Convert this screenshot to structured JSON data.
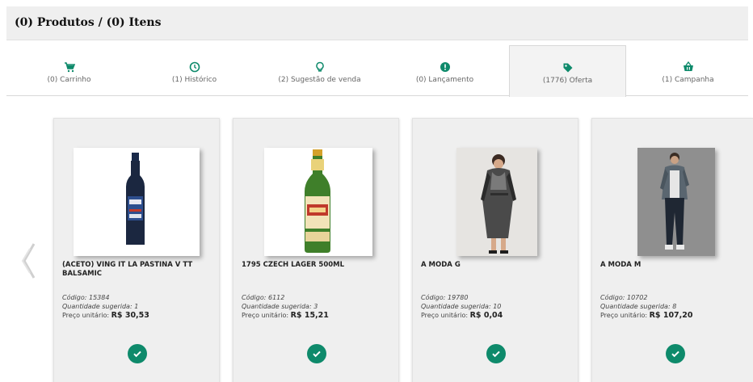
{
  "header": {
    "title": "(0) Produtos / (0) Itens"
  },
  "tabs": [
    {
      "label": "(0) Carrinho",
      "icon": "cart-icon"
    },
    {
      "label": "(1) Histórico",
      "icon": "history-icon"
    },
    {
      "label": "(2) Sugestão de venda",
      "icon": "lightbulb-icon"
    },
    {
      "label": "(0) Lançamento",
      "icon": "new-badge-icon"
    },
    {
      "label": "(1776) Oferta",
      "icon": "tag-icon",
      "active": true
    },
    {
      "label": "(1) Campanha",
      "icon": "basket-icon"
    }
  ],
  "labels": {
    "codigo": "Código:",
    "quantidade": "Quantidade sugerida:",
    "preco": "Preço unitário:"
  },
  "products": [
    {
      "name": "(ACETO) VING IT LA PASTINA V TT BALSAMIC",
      "code": "15384",
      "qty": "1",
      "price": "R$ 30,53",
      "image": "vinegar-bottle"
    },
    {
      "name": "1795 CZECH LAGER 500ML",
      "code": "6112",
      "qty": "3",
      "price": "R$ 15,21",
      "image": "beer-bottle"
    },
    {
      "name": "A MODA G",
      "code": "19780",
      "qty": "10",
      "price": "R$ 0,04",
      "image": "woman-dress"
    },
    {
      "name": "A MODA M",
      "code": "10702",
      "qty": "8",
      "price": "R$ 107,20",
      "image": "man-casual"
    }
  ],
  "colors": {
    "accent": "#0e8a6b",
    "header_bg": "#efefef",
    "card_bg": "#efefef"
  }
}
